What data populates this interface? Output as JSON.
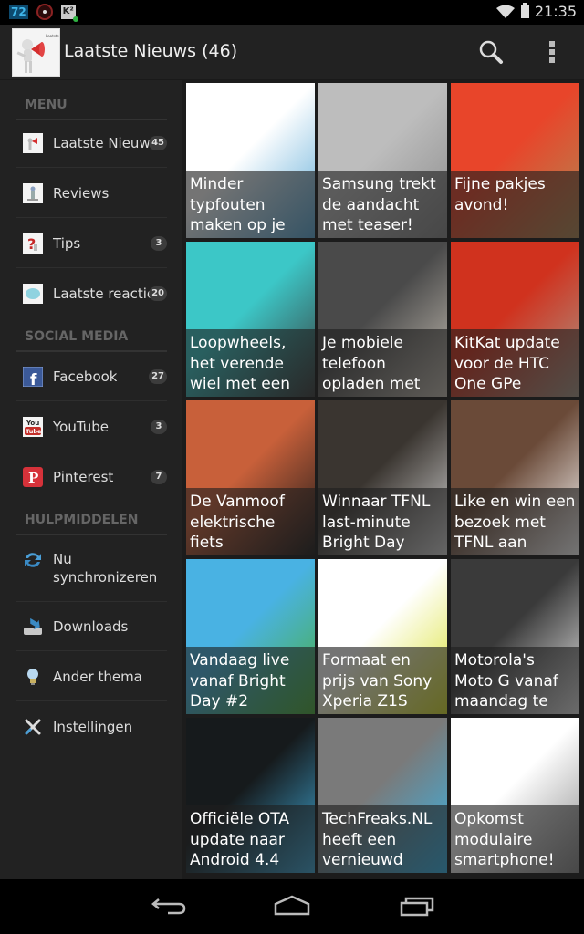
{
  "status_bar": {
    "temperature": "72",
    "k_badge": "K²",
    "time": "21:35",
    "icons": [
      "temperature-icon",
      "record-icon",
      "k-app-icon",
      "wifi-icon",
      "battery-icon"
    ]
  },
  "action_bar": {
    "logo_text": "Laatste Nieuws",
    "title": "Laatste Nieuws (46)",
    "search_icon": "search-icon",
    "overflow_icon": "overflow-menu-icon"
  },
  "drawer": {
    "sections": [
      {
        "header": "MENU",
        "items": [
          {
            "label": "Laatste Nieuws",
            "count": "45",
            "icon": "megaphone-icon"
          },
          {
            "label": "Reviews",
            "count": null,
            "icon": "reviews-icon"
          },
          {
            "label": "Tips",
            "count": "3",
            "icon": "question-icon"
          },
          {
            "label": "Laatste reacties",
            "count": "20",
            "icon": "speech-bubble-icon"
          }
        ]
      },
      {
        "header": "SOCIAL MEDIA",
        "items": [
          {
            "label": "Facebook",
            "count": "27",
            "icon": "facebook-icon"
          },
          {
            "label": "YouTube",
            "count": "3",
            "icon": "youtube-icon"
          },
          {
            "label": "Pinterest",
            "count": "7",
            "icon": "pinterest-icon"
          }
        ]
      },
      {
        "header": "HULPMIDDELEN",
        "items": [
          {
            "label": "Nu synchronizeren",
            "count": null,
            "icon": "sync-icon"
          },
          {
            "label": "Downloads",
            "count": null,
            "icon": "download-icon"
          },
          {
            "label": "Ander thema",
            "count": null,
            "icon": "lightbulb-icon"
          },
          {
            "label": "Instellingen",
            "count": null,
            "icon": "settings-tools-icon"
          }
        ]
      }
    ]
  },
  "articles": [
    {
      "title": "Minder typfouten maken op je",
      "image": "phone-keyboard-image",
      "colors": [
        "#ffffff",
        "#5aa9d6"
      ]
    },
    {
      "title": "Samsung trekt de aandacht met teaser!",
      "image": "samsung-camera-image",
      "colors": [
        "#bdbdbd",
        "#8a8a8a"
      ]
    },
    {
      "title": "Fijne pakjes avond!",
      "image": "gift-sack-image",
      "colors": [
        "#e8452a",
        "#b08a55"
      ]
    },
    {
      "title": "Loopwheels, het verende wiel met een",
      "image": "loopwheels-image",
      "colors": [
        "#3cc7c7",
        "#3a3a3a"
      ]
    },
    {
      "title": "Je mobiele telefoon opladen met",
      "image": "man-glasses-image",
      "colors": [
        "#4a4a4a",
        "#c7c0b5"
      ]
    },
    {
      "title": "KitKat update voor de HTC One GPe",
      "image": "htc-phones-image",
      "colors": [
        "#d0321e",
        "#a89a8a"
      ]
    },
    {
      "title": "De Vanmoof elektrische fiets",
      "image": "vanmoof-stage-image",
      "colors": [
        "#c8603a",
        "#1a1a1a"
      ]
    },
    {
      "title": "Winnaar TFNL last-minute Bright Day",
      "image": "winner-photo-image",
      "colors": [
        "#3a3530",
        "#d8d8d8"
      ]
    },
    {
      "title": "Like en win een bezoek met TFNL aan",
      "image": "building-image",
      "colors": [
        "#6a4a38",
        "#ffffff"
      ]
    },
    {
      "title": "Vandaag live vanaf Bright Day #2",
      "image": "bright-day-image",
      "colors": [
        "#49b2e3",
        "#4caf3a"
      ]
    },
    {
      "title": "Formaat en prijs van Sony Xperia Z1S",
      "image": "xperia-phones-image",
      "colors": [
        "#ffffff",
        "#d9e02a"
      ]
    },
    {
      "title": "Motorola's Moto G vanaf maandag te",
      "image": "moto-g-image",
      "colors": [
        "#3a3a3a",
        "#e8e8e8"
      ]
    },
    {
      "title": "Officiële OTA update naar Android 4.4",
      "image": "system-update-image",
      "colors": [
        "#161a1c",
        "#3fa8d6"
      ]
    },
    {
      "title": "TechFreaks.NL heeft een vernieuwd",
      "image": "tfnl-logo-image",
      "colors": [
        "#7a7a7a",
        "#37b6ea"
      ]
    },
    {
      "title": "Opkomst modulaire smartphone!",
      "image": "modular-phone-image",
      "colors": [
        "#ffffff",
        "#8a8a8a"
      ]
    }
  ],
  "nav_bar": {
    "back": "back-icon",
    "home": "home-icon",
    "recents": "recents-icon"
  }
}
